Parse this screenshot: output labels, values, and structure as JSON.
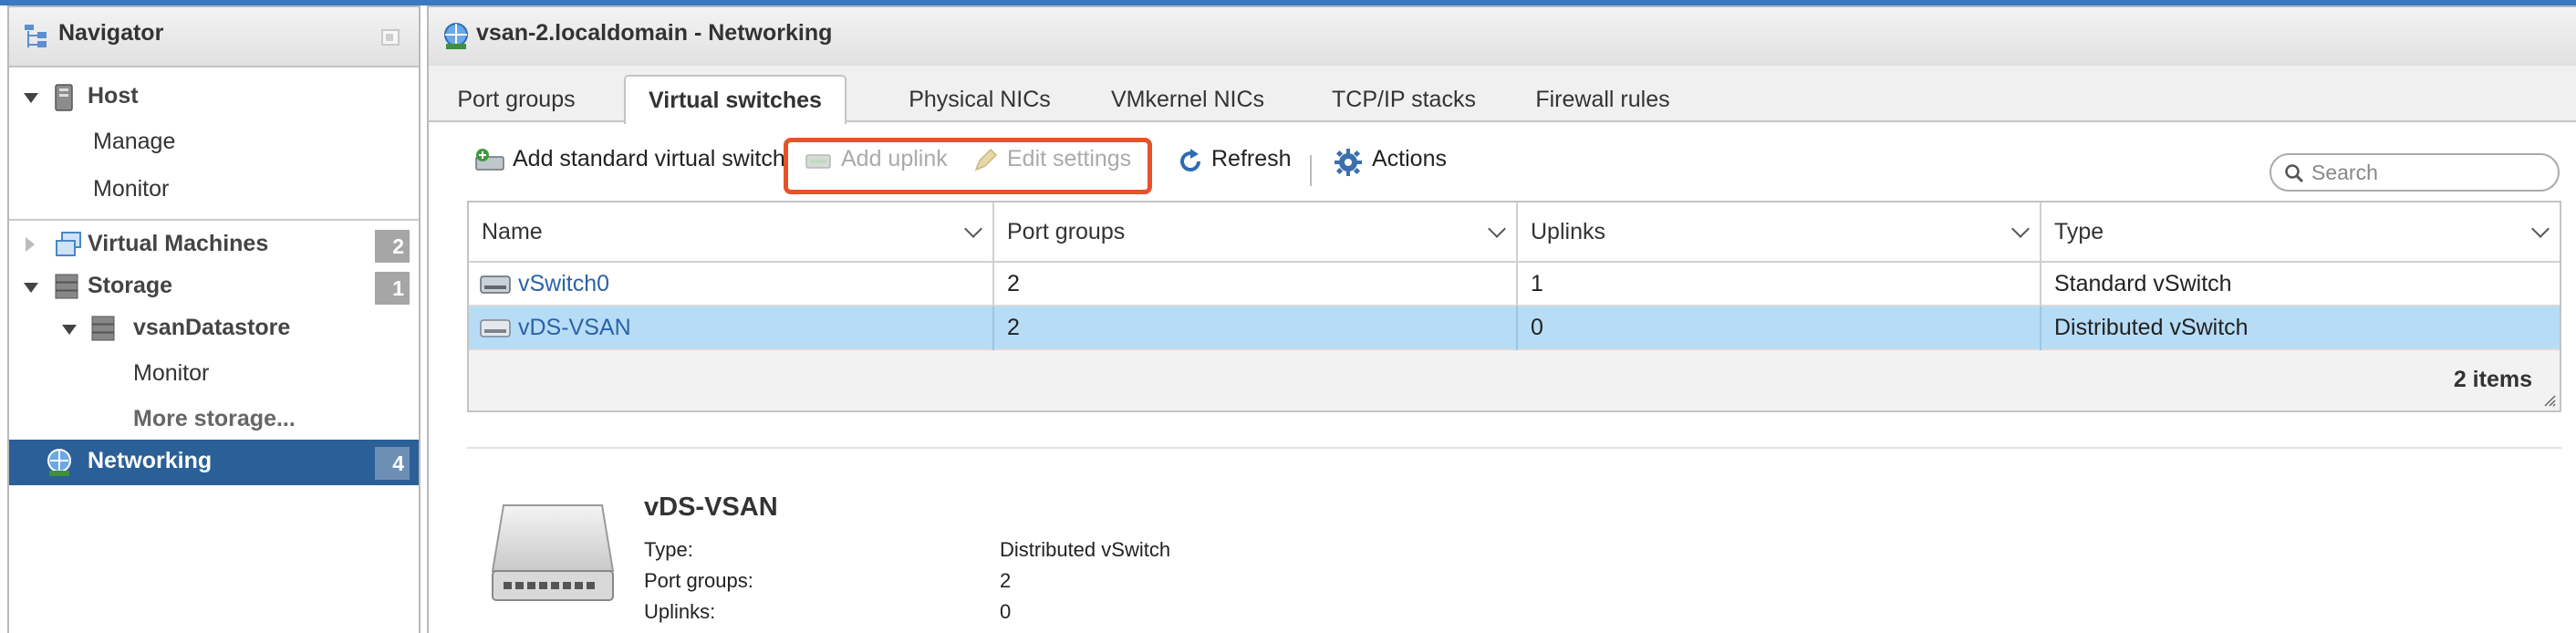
{
  "navigator": {
    "title": "Navigator",
    "host": {
      "label": "Host",
      "children": [
        "Manage",
        "Monitor"
      ]
    },
    "virtual_machines": {
      "label": "Virtual Machines",
      "count": "2"
    },
    "storage": {
      "label": "Storage",
      "count": "1",
      "datastore": {
        "label": "vsanDatastore",
        "monitor": "Monitor"
      },
      "more": "More storage..."
    },
    "networking": {
      "label": "Networking",
      "count": "4"
    }
  },
  "main": {
    "title": "vsan-2.localdomain - Networking",
    "tabs": [
      {
        "label": "Port groups",
        "active": false
      },
      {
        "label": "Virtual switches",
        "active": true
      },
      {
        "label": "Physical NICs",
        "active": false
      },
      {
        "label": "VMkernel NICs",
        "active": false
      },
      {
        "label": "TCP/IP stacks",
        "active": false
      },
      {
        "label": "Firewall rules",
        "active": false
      }
    ],
    "toolbar": {
      "add_switch": "Add standard virtual switch",
      "add_uplink": "Add uplink",
      "edit_settings": "Edit settings",
      "refresh": "Refresh",
      "actions": "Actions",
      "search_placeholder": "Search"
    },
    "table": {
      "columns": [
        "Name",
        "Port groups",
        "Uplinks",
        "Type"
      ],
      "rows": [
        {
          "name": "vSwitch0",
          "port_groups": "2",
          "uplinks": "1",
          "type": "Standard vSwitch",
          "selected": false
        },
        {
          "name": "vDS-VSAN",
          "port_groups": "2",
          "uplinks": "0",
          "type": "Distributed vSwitch",
          "selected": true
        }
      ],
      "items_count": "2 items"
    },
    "detail": {
      "title": "vDS-VSAN",
      "fields": [
        {
          "label": "Type:",
          "value": "Distributed vSwitch"
        },
        {
          "label": "Port groups:",
          "value": "2"
        },
        {
          "label": "Uplinks:",
          "value": "0"
        }
      ]
    }
  },
  "colors": {
    "selected_nav": "#2b5f97",
    "selected_row": "#b7dcf6",
    "highlight_box": "#e8522a",
    "link": "#2a62a8"
  }
}
